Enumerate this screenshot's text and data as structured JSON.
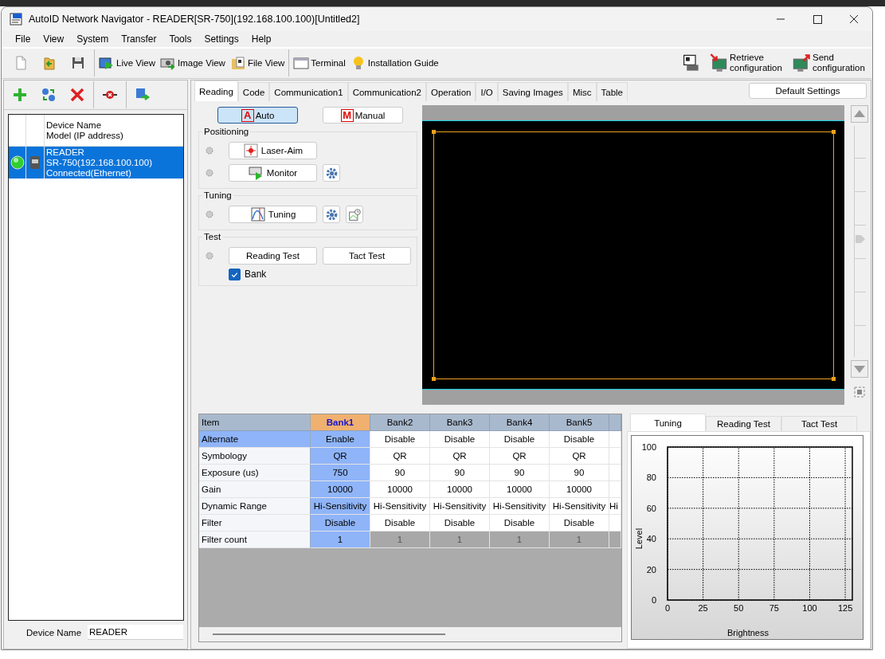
{
  "window": {
    "title": "AutoID Network Navigator - READER[SR-750](192.168.100.100)[Untitled2]"
  },
  "menu": [
    "File",
    "View",
    "System",
    "Transfer",
    "Tools",
    "Settings",
    "Help"
  ],
  "toolbar": {
    "groups": [
      [
        {
          "kind": "new"
        },
        {
          "kind": "open"
        },
        {
          "kind": "save"
        }
      ],
      [
        {
          "kind": "live-view",
          "label": "Live View"
        },
        {
          "kind": "image-view",
          "label": "Image View"
        },
        {
          "kind": "file-view",
          "label": "File View"
        }
      ],
      [
        {
          "kind": "terminal",
          "label": "Terminal"
        },
        {
          "kind": "guide",
          "label": "Installation Guide"
        }
      ]
    ],
    "right": [
      {
        "kind": "print"
      },
      {
        "kind": "retrieve",
        "label": "Retrieve configuration"
      },
      {
        "kind": "send",
        "label": "Send configuration"
      }
    ]
  },
  "device_toolbar": [
    {
      "kind": "add"
    },
    {
      "kind": "refresh"
    },
    {
      "kind": "delete"
    },
    {
      "kind": "disconnect"
    },
    {
      "kind": "ip"
    }
  ],
  "device_list": {
    "header": [
      "Device Name",
      "Model (IP address)"
    ],
    "devices": [
      {
        "lines": [
          "READER",
          "SR-750(192.168.100.100)",
          "Connected(Ethernet)"
        ],
        "selected": true,
        "connected": true
      }
    ]
  },
  "device_name_field": {
    "label": "Device Name",
    "value": "READER"
  },
  "tabs": [
    {
      "label": "Reading",
      "selected": true
    },
    {
      "label": "Code",
      "selected": false
    },
    {
      "label": "Communication1",
      "selected": false
    },
    {
      "label": "Communication2",
      "selected": false
    },
    {
      "label": "Operation",
      "selected": false
    },
    {
      "label": "I/O",
      "selected": false
    },
    {
      "label": "Saving Images",
      "selected": false
    },
    {
      "label": "Misc",
      "selected": false
    },
    {
      "label": "Table",
      "selected": false
    }
  ],
  "default_button": "Default Settings",
  "modes": [
    {
      "letter": "A",
      "label": "Auto",
      "selected": true
    },
    {
      "letter": "M",
      "label": "Manual",
      "selected": false
    }
  ],
  "groups": [
    {
      "title": "Positioning",
      "rows": [
        {
          "buttons": [
            {
              "kind": "laser",
              "label": "Laser-Aim"
            }
          ],
          "extras": []
        },
        {
          "buttons": [
            {
              "kind": "monitor",
              "label": "Monitor"
            }
          ],
          "extras": [
            {
              "kind": "gear"
            }
          ]
        }
      ]
    },
    {
      "title": "Tuning",
      "rows": [
        {
          "buttons": [
            {
              "kind": "tuning",
              "label": "Tuning"
            }
          ],
          "extras": [
            {
              "kind": "gear"
            },
            {
              "kind": "history"
            }
          ]
        }
      ]
    },
    {
      "title": "Test",
      "rows": [
        {
          "buttons": [
            {
              "kind": "plain",
              "label": "Reading Test"
            },
            {
              "kind": "plain",
              "label": "Tact Test"
            }
          ],
          "extras": []
        }
      ],
      "checkbox": {
        "label": "Bank",
        "checked": true
      }
    }
  ],
  "zoom_slider": {
    "level": 0.5
  },
  "table": {
    "columns": [
      {
        "label": "Item",
        "selected": false
      },
      {
        "label": "Bank1",
        "selected": true
      },
      {
        "label": "Bank2",
        "selected": false
      },
      {
        "label": "Bank3",
        "selected": false
      },
      {
        "label": "Bank4",
        "selected": false
      },
      {
        "label": "Bank5",
        "selected": false
      }
    ],
    "rows": [
      {
        "cells": [
          "Alternate",
          "Enable",
          "Disable",
          "Disable",
          "Disable",
          "Disable"
        ],
        "selected": true,
        "dimmed": false
      },
      {
        "cells": [
          "Symbology",
          "QR",
          "QR",
          "QR",
          "QR",
          "QR"
        ],
        "selected": false,
        "dimmed": false
      },
      {
        "cells": [
          "Exposure (us)",
          "750",
          "90",
          "90",
          "90",
          "90"
        ],
        "selected": false,
        "dimmed": false
      },
      {
        "cells": [
          "Gain",
          "10000",
          "10000",
          "10000",
          "10000",
          "10000"
        ],
        "selected": false,
        "dimmed": false
      },
      {
        "cells": [
          "Dynamic Range",
          "Hi-Sensitivity",
          "Hi-Sensitivity",
          "Hi-Sensitivity",
          "Hi-Sensitivity",
          "Hi-Sensitivity",
          "Hi"
        ],
        "selected": false,
        "dimmed": false
      },
      {
        "cells": [
          "Filter",
          "Disable",
          "Disable",
          "Disable",
          "Disable",
          "Disable"
        ],
        "selected": false,
        "dimmed": false
      },
      {
        "cells": [
          "Filter count",
          "1",
          "1",
          "1",
          "1",
          "1"
        ],
        "selected": false,
        "dimmed": true
      }
    ]
  },
  "chart_panel": {
    "tabs": [
      {
        "label": "Tuning",
        "selected": true
      },
      {
        "label": "Reading Test",
        "selected": false
      },
      {
        "label": "Tact Test",
        "selected": false
      }
    ],
    "chart_data": {
      "type": "line",
      "grid": true,
      "xlabel": "Brightness",
      "ylabel": "Level",
      "xlim": [
        0,
        130
      ],
      "ylim": [
        0,
        100
      ],
      "xticks": [
        0,
        25,
        50,
        75,
        100,
        125
      ],
      "yticks": [
        0,
        20,
        40,
        60,
        80,
        100
      ]
    }
  }
}
